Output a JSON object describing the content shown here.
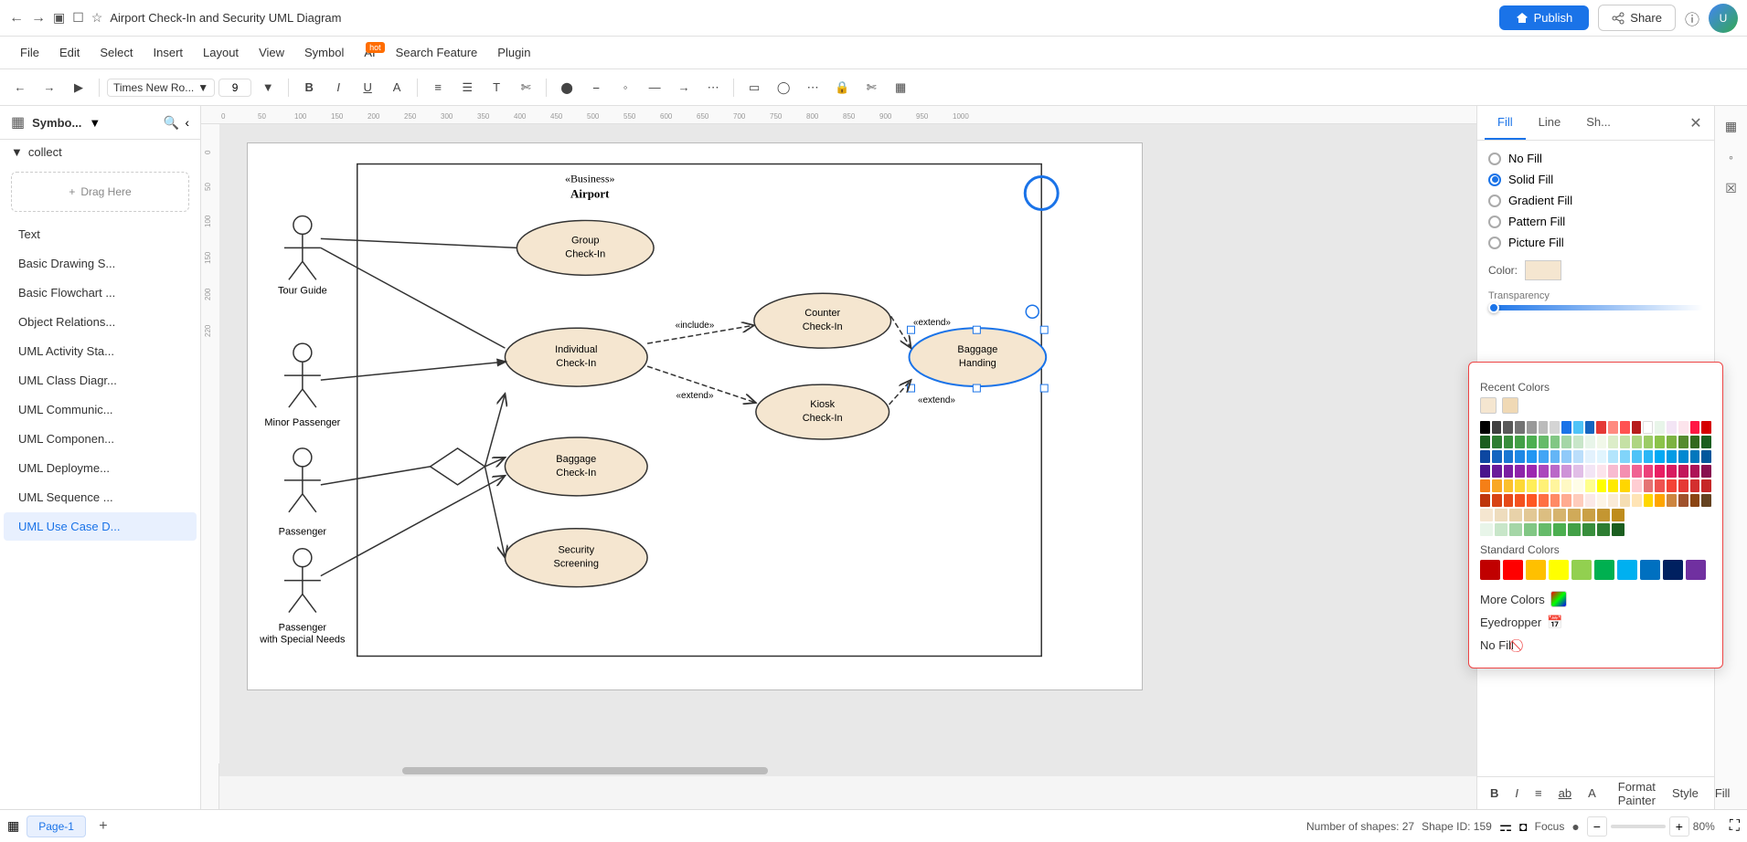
{
  "titleBar": {
    "title": "Airport Check-In and Security UML Diagram",
    "publishLabel": "Publish",
    "shareLabel": "Share"
  },
  "menuBar": {
    "items": [
      "File",
      "Edit",
      "Select",
      "Insert",
      "Layout",
      "View",
      "Symbol",
      "AI",
      "Search Feature",
      "Plugin"
    ]
  },
  "toolbar": {
    "fontFamily": "Times New Ro...",
    "fontSize": "9",
    "buttons": [
      "undo",
      "redo",
      "pointer",
      "bold",
      "italic",
      "underline",
      "font-color",
      "align-left",
      "align-center",
      "text-style",
      "crop",
      "fill-color",
      "line-color",
      "corner",
      "line-style",
      "arrow-style",
      "dash-style",
      "shape-rect",
      "shape-ellipse",
      "more"
    ]
  },
  "sidebar": {
    "title": "Symbo...",
    "collection": "collect",
    "dragHereLabel": "Drag Here",
    "items": [
      {
        "label": "Text",
        "id": "text"
      },
      {
        "label": "Basic Drawing S...",
        "id": "basic-drawing"
      },
      {
        "label": "Basic Flowchart ...",
        "id": "basic-flowchart"
      },
      {
        "label": "Object Relations...",
        "id": "object-relations"
      },
      {
        "label": "UML Activity Sta...",
        "id": "uml-activity"
      },
      {
        "label": "UML Class Diagr...",
        "id": "uml-class"
      },
      {
        "label": "UML Communic...",
        "id": "uml-communication"
      },
      {
        "label": "UML Componen...",
        "id": "uml-component"
      },
      {
        "label": "UML Deployme...",
        "id": "uml-deployment"
      },
      {
        "label": "UML Sequence ...",
        "id": "uml-sequence"
      },
      {
        "label": "UML Use Case D...",
        "id": "uml-use-case"
      }
    ]
  },
  "diagram": {
    "title": "Airport Check-In and Security UML Diagram"
  },
  "rightPanel": {
    "tabs": [
      "Fill",
      "Line",
      "Sh..."
    ],
    "fillOptions": [
      {
        "label": "No Fill",
        "selected": false
      },
      {
        "label": "Solid Fill",
        "selected": true
      },
      {
        "label": "Gradient Fill",
        "selected": false
      },
      {
        "label": "Pattern Fill",
        "selected": false
      },
      {
        "label": "Picture Fill",
        "selected": false
      }
    ],
    "colorLabel": "Color:",
    "recentColorsLabel": "Recent Colors",
    "recentColors": [
      "#f5e6d0",
      "#f0d9b5"
    ],
    "standardColorsLabel": "Standard Colors",
    "standardColors": [
      "#c00000",
      "#ff0000",
      "#ffc000",
      "#ffff00",
      "#92d050",
      "#00b050",
      "#00b0f0",
      "#0070c0",
      "#002060",
      "#7030a0"
    ],
    "moreColorsLabel": "More Colors",
    "eyedropperLabel": "Eyedropper",
    "noFillLabel": "No Fill"
  },
  "statusBar": {
    "pageLabel": "Page-1",
    "shapeCount": "Number of shapes: 27",
    "shapeId": "Shape ID: 159",
    "focusLabel": "Focus",
    "zoom": "80%"
  },
  "colorGrid": {
    "rows": [
      [
        "#000000",
        "#1a1a1a",
        "#333333",
        "#4d4d4d",
        "#666666",
        "#808080",
        "#999999",
        "#b3b3b3",
        "#cccccc",
        "#e6e6e6",
        "#ffffff",
        "#ffcccc",
        "#ff9999",
        "#ff6666",
        "#ff3333",
        "#ff0000",
        "#cc0000",
        "#990000",
        "#660000",
        "#330000"
      ],
      [
        "#003300",
        "#006600",
        "#009900",
        "#00cc00",
        "#00ff00",
        "#33ff33",
        "#66ff66",
        "#99ff99",
        "#ccffcc",
        "#e6ffe6",
        "#e6f5e6",
        "#ccffcc",
        "#99ee99",
        "#66dd66",
        "#33cc33",
        "#009900",
        "#007700",
        "#005500",
        "#003300",
        "#001100"
      ],
      [
        "#000033",
        "#000066",
        "#000099",
        "#0000cc",
        "#0000ff",
        "#3333ff",
        "#6666ff",
        "#9999ff",
        "#ccccff",
        "#e6e6ff",
        "#e6eeff",
        "#ccdeff",
        "#99bbff",
        "#6699ff",
        "#3377ff",
        "#0055ff",
        "#0044cc",
        "#003399",
        "#002266",
        "#001133"
      ],
      [
        "#330033",
        "#660066",
        "#990099",
        "#cc00cc",
        "#ff00ff",
        "#ff33ff",
        "#ff66ff",
        "#ff99ff",
        "#ffccff",
        "#ffe6ff",
        "#fff0f5",
        "#ffd6e8",
        "#ffadd2",
        "#ff85bb",
        "#ff5ca5",
        "#ff338e",
        "#cc006b",
        "#990050",
        "#660035",
        "#33001a"
      ],
      [
        "#332200",
        "#664400",
        "#997700",
        "#ccaa00",
        "#ffdd00",
        "#ffee33",
        "#fff066",
        "#fff399",
        "#fff5bb",
        "#fff8dd",
        "#fffff0",
        "#fffde6",
        "#fffacc",
        "#fff7b3",
        "#fff499",
        "#fff080",
        "#ccbb00",
        "#998800",
        "#665500",
        "#332200"
      ],
      [
        "#1a0a00",
        "#3d1a00",
        "#7a3300",
        "#b84d00",
        "#e85c00",
        "#ff7700",
        "#ff9933",
        "#ffbb66",
        "#ffdd99",
        "#fff0cc",
        "#fdf5e6",
        "#faebd7",
        "#f5deb3",
        "#ffe4b5",
        "#ffd700",
        "#ffa500",
        "#cc7722",
        "#996633",
        "#664400",
        "#331a00"
      ],
      [
        "#f5e6d0",
        "#eedcbd",
        "#e8d2a9",
        "#e2c895",
        "#dcbe81",
        "#d6b46d",
        "#d0aa59",
        "#caa045",
        "#c49631",
        "#be8c1d"
      ],
      [
        "#e8f5e9",
        "#c8e6c9",
        "#a5d6a7",
        "#81c784",
        "#66bb6a",
        "#4caf50",
        "#43a047",
        "#388e3c",
        "#2e7d32",
        "#1b5e20"
      ]
    ]
  }
}
